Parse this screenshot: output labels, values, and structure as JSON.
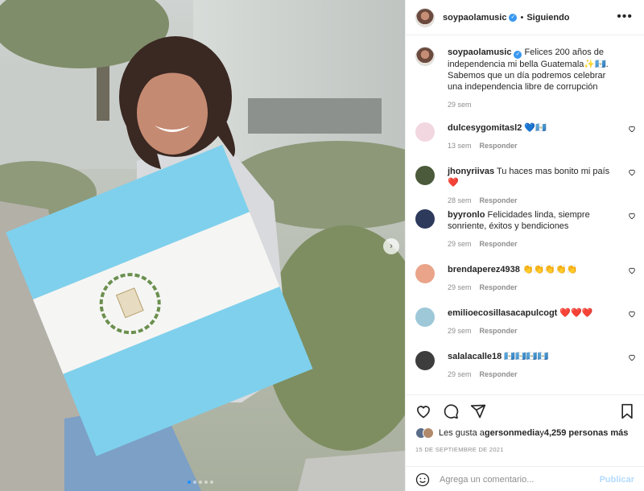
{
  "post": {
    "username": "soypaolamusic",
    "follow_status": "Siguiendo",
    "dot": "•",
    "more": "•••"
  },
  "caption": {
    "username": "soypaolamusic",
    "text": " Felices 200 años de independencia mi bella Guatemala✨🇬🇹. Sabemos que un día podremos celebrar una independencia libre de corrupción",
    "time": "29 sem"
  },
  "comments": [
    {
      "user": "dulcesygomitasl2",
      "text": "💙🇬🇹",
      "time": "13 sem",
      "reply": "Responder"
    },
    {
      "user": "jhonyriivas",
      "text": "Tu haces mas bonito mi país ❤️",
      "time": "28 sem",
      "reply": "Responder"
    },
    {
      "user": "byyronlo",
      "text": "Felicidades linda, siempre sonriente, éxitos y bendiciones",
      "time": "29 sem",
      "reply": "Responder"
    },
    {
      "user": "brendaperez4938",
      "text": "👏👏👏👏👏",
      "time": "29 sem",
      "reply": "Responder"
    },
    {
      "user": "emilioecosillasacapulcogt",
      "text": "❤️❤️❤️",
      "time": "29 sem",
      "reply": "Responder"
    },
    {
      "user": "salalacalle18",
      "text": "🇬🇹🇬🇹🇬🇹🇬🇹",
      "time": "29 sem",
      "reply": "Responder"
    }
  ],
  "likes": {
    "prefix": "Les gusta a ",
    "user": "gersonmedia",
    "middle": " y ",
    "count": "4,259 personas más"
  },
  "date": "15 DE SEPTIEMBRE DE 2021",
  "add_comment": {
    "placeholder": "Agrega un comentario...",
    "publish": "Publicar"
  },
  "carousel": {
    "total": 5,
    "active": 1
  },
  "colors": {
    "verified": "#3897f0",
    "flag_blue": "#6fc6ee",
    "publish": "#b3dbff"
  }
}
